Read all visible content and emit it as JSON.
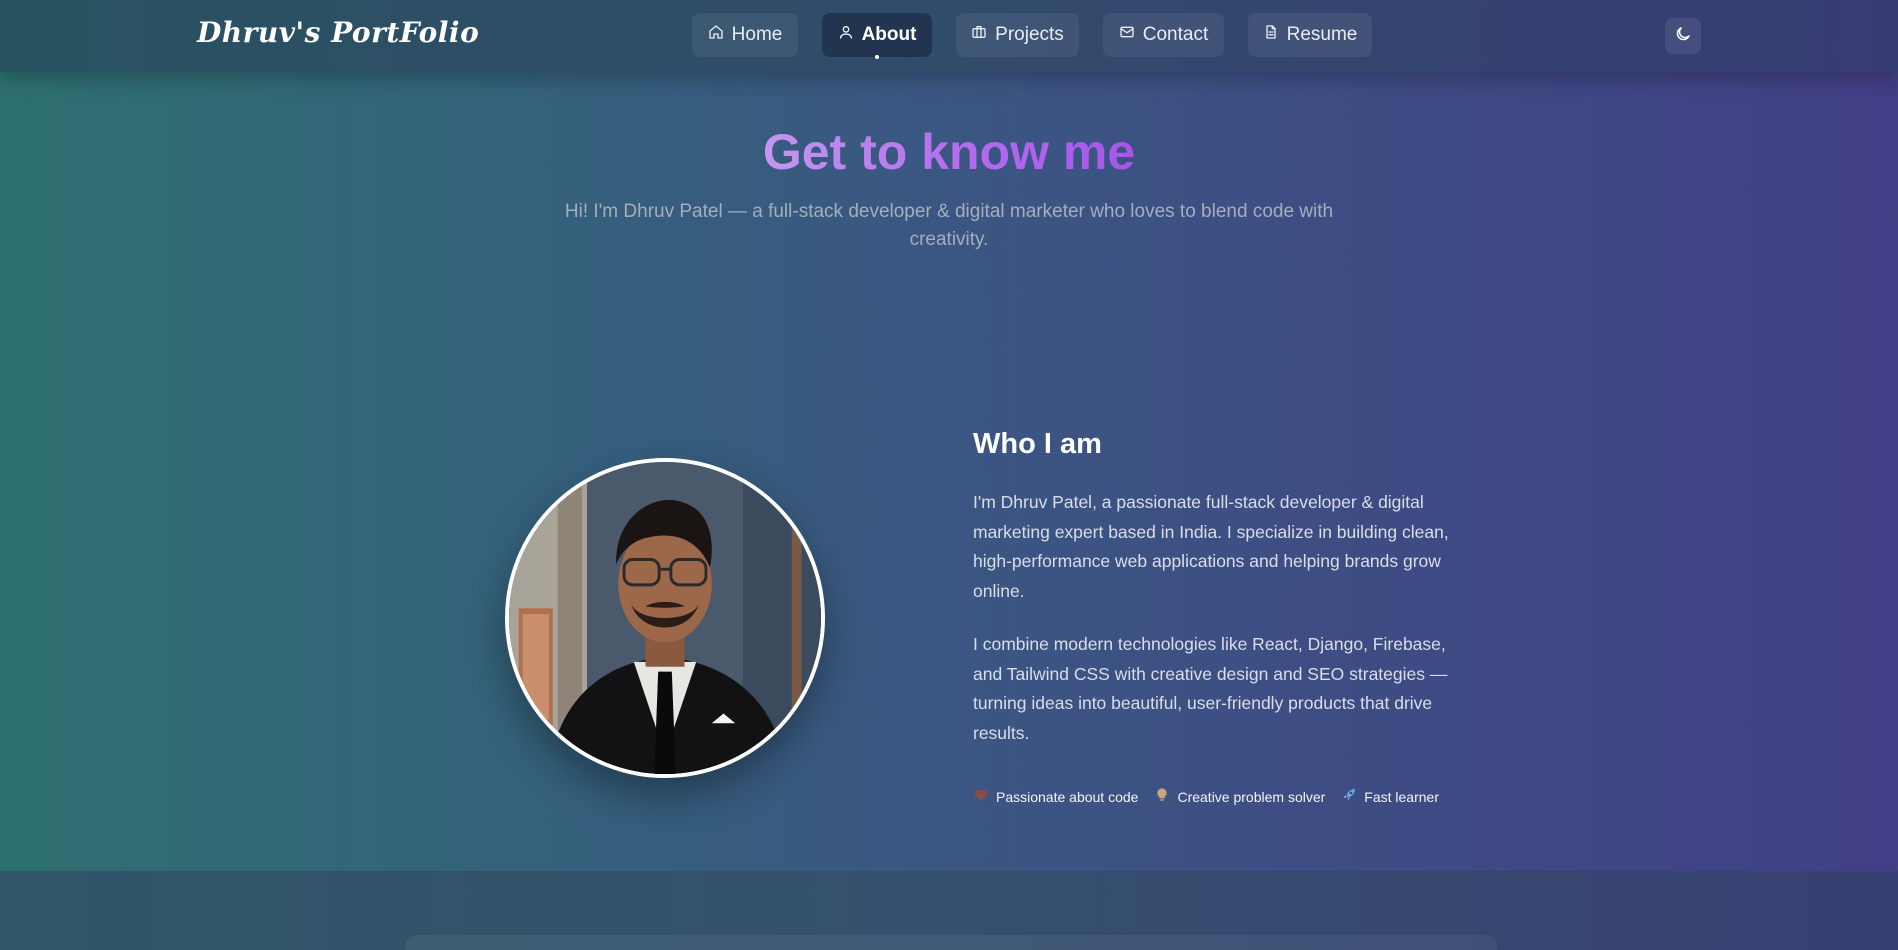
{
  "brand": {
    "title": "Dhruv's PortFolio"
  },
  "nav": {
    "items": [
      {
        "label": "Home",
        "icon": "home-icon",
        "active": false
      },
      {
        "label": "About",
        "icon": "user-icon",
        "active": true
      },
      {
        "label": "Projects",
        "icon": "briefcase-icon",
        "active": false
      },
      {
        "label": "Contact",
        "icon": "mail-icon",
        "active": false
      },
      {
        "label": "Resume",
        "icon": "file-icon",
        "active": false
      }
    ],
    "theme_toggle_icon": "moon-icon"
  },
  "hero": {
    "title": "Get to know me",
    "subtitle": "Hi! I'm Dhruv Patel — a full-stack developer & digital marketer who loves to blend code with creativity."
  },
  "about": {
    "heading": "Who I am",
    "paragraph1": "I'm Dhruv Patel, a passionate full-stack developer & digital marketing expert based in India. I specialize in building clean, high-performance web applications and helping brands grow online.",
    "paragraph2": "I combine modern technologies like React, Django, Firebase, and Tailwind CSS with creative design and SEO strategies — turning ideas into beautiful, user-friendly products that drive results.",
    "traits": [
      {
        "label": "Passionate about code",
        "icon": "heart-icon"
      },
      {
        "label": "Creative problem solver",
        "icon": "lightbulb-icon"
      },
      {
        "label": "Fast learner",
        "icon": "rocket-icon"
      }
    ]
  },
  "colors": {
    "accent_gradient_start": "#c497ee",
    "accent_gradient_end": "#a556ea",
    "heart": "#8b4a4a",
    "bulb": "#c9a67a",
    "rocket": "#6aa7d8"
  }
}
